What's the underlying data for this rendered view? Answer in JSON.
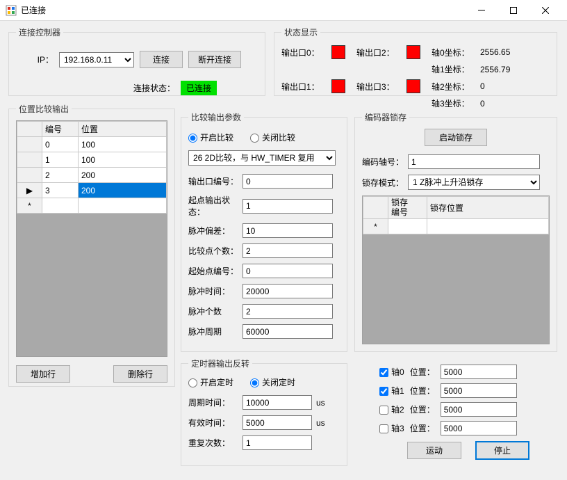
{
  "window": {
    "title": "已连接"
  },
  "connection": {
    "legend": "连接控制器",
    "ip_label": "IP：",
    "ip_value": "192.168.0.11",
    "connect_label": "连接",
    "disconnect_label": "断开连接",
    "status_label": "连接状态：",
    "status_value": "已连接"
  },
  "status": {
    "legend": "状态显示",
    "out0_label": "输出口0：",
    "out1_label": "输出口1：",
    "out2_label": "输出口2：",
    "out3_label": "输出口3：",
    "axis0_label": "轴0坐标：",
    "axis1_label": "轴1坐标：",
    "axis2_label": "轴2坐标：",
    "axis3_label": "轴3坐标：",
    "axis0_value": "2556.65",
    "axis1_value": "2556.79",
    "axis2_value": "0",
    "axis3_value": "0",
    "output_color": "#ff0000"
  },
  "pos_table": {
    "legend": "位置比较输出",
    "col_index": "编号",
    "col_pos": "位置",
    "rows": [
      {
        "index": "0",
        "pos": "100"
      },
      {
        "index": "1",
        "pos": "100"
      },
      {
        "index": "2",
        "pos": "200"
      },
      {
        "index": "3",
        "pos": "200"
      }
    ],
    "selected_marker": "▶",
    "new_marker": "*",
    "add_row_label": "增加行",
    "del_row_label": "删除行"
  },
  "compare": {
    "legend": "比较输出参数",
    "radio_on": "开启比较",
    "radio_off": "关闭比较",
    "mode_value": "26 2D比较，与 HW_TIMER 复用",
    "out_index_label": "输出口编号：",
    "out_index_value": "0",
    "start_state_label": "起点输出状态：",
    "start_state_value": "1",
    "pulse_offset_label": "脉冲偏差：",
    "pulse_offset_value": "10",
    "point_count_label": "比较点个数：",
    "point_count_value": "2",
    "start_point_label": "起始点编号：",
    "start_point_value": "0",
    "pulse_time_label": "脉冲时间：",
    "pulse_time_value": "20000",
    "pulse_count_label": "脉冲个数",
    "pulse_count_value": "2",
    "pulse_period_label": "脉冲周期",
    "pulse_period_value": "60000"
  },
  "timer": {
    "legend": "定时器输出反转",
    "radio_on": "开启定时",
    "radio_off": "关闭定时",
    "period_label": "周期时间：",
    "period_value": "10000",
    "valid_label": "有效时间：",
    "valid_value": "5000",
    "repeat_label": "重复次数：",
    "repeat_value": "1",
    "unit": "us"
  },
  "latch": {
    "legend": "编码器锁存",
    "start_label": "启动锁存",
    "axis_label": "编码轴号：",
    "axis_value": "1",
    "mode_label": "锁存模式：",
    "mode_value": "1 Z脉冲上升沿锁存",
    "col_index": "锁存\n编号",
    "col_pos": "锁存位置",
    "new_marker": "*"
  },
  "motion": {
    "axis0_label": "轴0",
    "axis1_label": "轴1",
    "axis2_label": "轴2",
    "axis3_label": "轴3",
    "pos_label": "位置：",
    "pos0": "5000",
    "pos1": "5000",
    "pos2": "5000",
    "pos3": "5000",
    "run_label": "运动",
    "stop_label": "停止"
  }
}
